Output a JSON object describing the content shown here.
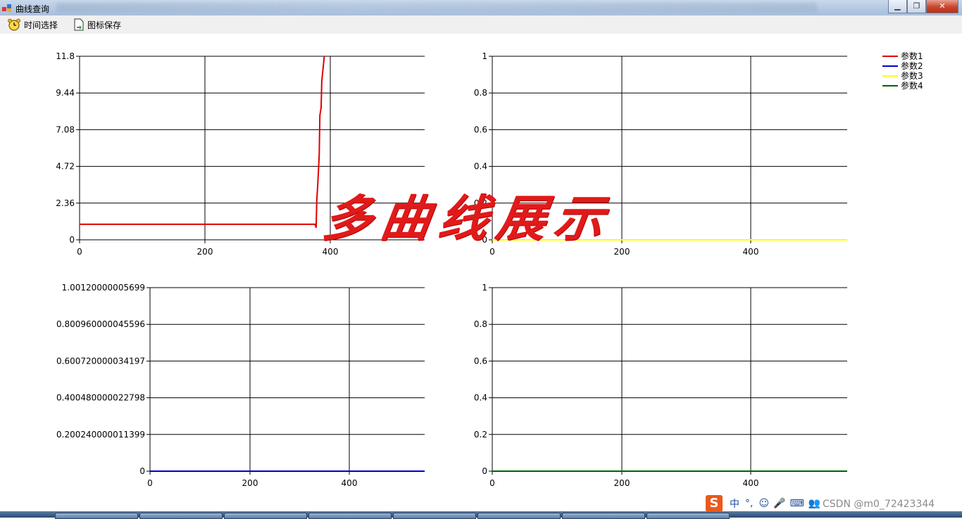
{
  "window": {
    "title": "曲线查询",
    "minimize_label": "▁",
    "maximize_label": "❐",
    "close_label": "✕"
  },
  "toolbar": {
    "time_select_label": "时间选择",
    "save_chart_label": "图标保存"
  },
  "overlay_title": "多曲线展示",
  "legend": [
    {
      "name": "参数1",
      "color": "#e00000"
    },
    {
      "name": "参数2",
      "color": "#0000c8"
    },
    {
      "name": "参数3",
      "color": "#ffff00"
    },
    {
      "name": "参数4",
      "color": "#006400"
    }
  ],
  "chart_data": [
    {
      "type": "line",
      "xlim": [
        0,
        550
      ],
      "ylim": [
        0,
        11.8
      ],
      "xticks": [
        "0",
        "200",
        "400"
      ],
      "yticks": [
        "0",
        "2.36",
        "4.72",
        "7.08",
        "9.44",
        "11.8"
      ],
      "series": [
        {
          "name": "参数1",
          "color": "#e00000",
          "x": [
            0,
            375,
            377,
            378,
            380,
            382,
            383,
            385,
            386,
            388,
            390
          ],
          "y": [
            1.0,
            1.0,
            0.8,
            2.5,
            3.8,
            5.5,
            8.0,
            8.5,
            10.2,
            11.0,
            11.8
          ]
        }
      ]
    },
    {
      "type": "line",
      "xlim": [
        0,
        550
      ],
      "ylim": [
        0,
        1
      ],
      "xticks": [
        "0",
        "200",
        "400"
      ],
      "yticks": [
        "0",
        "0.2",
        "0.4",
        "0.6",
        "0.8",
        "1"
      ],
      "series": [
        {
          "name": "参数3",
          "color": "#ffff00",
          "x": [
            0,
            550
          ],
          "y": [
            0,
            0
          ]
        }
      ]
    },
    {
      "type": "line",
      "xlim": [
        0,
        550
      ],
      "ylim": [
        0,
        1.00120000005699
      ],
      "xticks": [
        "0",
        "200",
        "400"
      ],
      "yticks": [
        "0",
        "0.200240000011399",
        "0.400480000022798",
        "0.600720000034197",
        "0.800960000045596",
        "1.00120000005699"
      ],
      "series": [
        {
          "name": "参数2",
          "color": "#0000c8",
          "x": [
            0,
            550
          ],
          "y": [
            0,
            0
          ]
        }
      ]
    },
    {
      "type": "line",
      "xlim": [
        0,
        550
      ],
      "ylim": [
        0,
        1
      ],
      "xticks": [
        "0",
        "200",
        "400"
      ],
      "yticks": [
        "0",
        "0.2",
        "0.4",
        "0.6",
        "0.8",
        "1"
      ],
      "series": [
        {
          "name": "参数4",
          "color": "#006400",
          "x": [
            0,
            550
          ],
          "y": [
            0,
            0
          ]
        }
      ]
    }
  ],
  "ime": {
    "logo": "S",
    "items": [
      "中",
      "°,",
      "☺",
      "🎤",
      "⌨",
      "👥",
      "↹",
      "⊞"
    ]
  },
  "watermark": "CSDN @m0_72423344"
}
